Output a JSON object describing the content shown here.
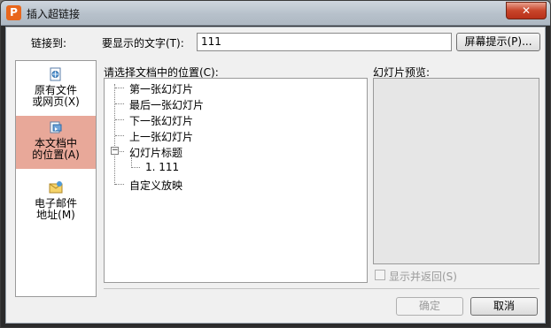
{
  "window": {
    "title": "插入超链接",
    "app_icon_glyph": "P",
    "close_glyph": "✕"
  },
  "form": {
    "link_to_label": "链接到:",
    "display_text_label": "要显示的文字(T):",
    "display_text_value": "111",
    "screen_tip_button": "屏幕提示(P)..."
  },
  "sidebar": {
    "items": [
      {
        "line1": "原有文件",
        "line2": "或网页(X)",
        "icon": "web-page-icon",
        "selected": false
      },
      {
        "line1": "本文档中",
        "line2": "的位置(A)",
        "icon": "document-place-icon",
        "selected": true
      },
      {
        "line1": "电子邮件",
        "line2": "地址(M)",
        "icon": "email-icon",
        "selected": false
      }
    ]
  },
  "location": {
    "label": "请选择文档中的位置(C):",
    "tree": [
      {
        "text": "第一张幻灯片",
        "level": 0
      },
      {
        "text": "最后一张幻灯片",
        "level": 0
      },
      {
        "text": "下一张幻灯片",
        "level": 0
      },
      {
        "text": "上一张幻灯片",
        "level": 0
      },
      {
        "text": "幻灯片标题",
        "level": 0,
        "expanded": true
      },
      {
        "text": "1. 111",
        "level": 1
      },
      {
        "text": "自定义放映",
        "level": 0
      }
    ],
    "toggle_glyph": "−"
  },
  "preview": {
    "label": "幻灯片预览:",
    "show_return_label": "显示并返回(S)",
    "show_return_checked": false
  },
  "buttons": {
    "ok": "确定",
    "cancel": "取消"
  },
  "colors": {
    "selected_sidebar_bg": "#e8a899",
    "close_button_red": "#c8452a",
    "app_icon_orange": "#e8661c"
  }
}
